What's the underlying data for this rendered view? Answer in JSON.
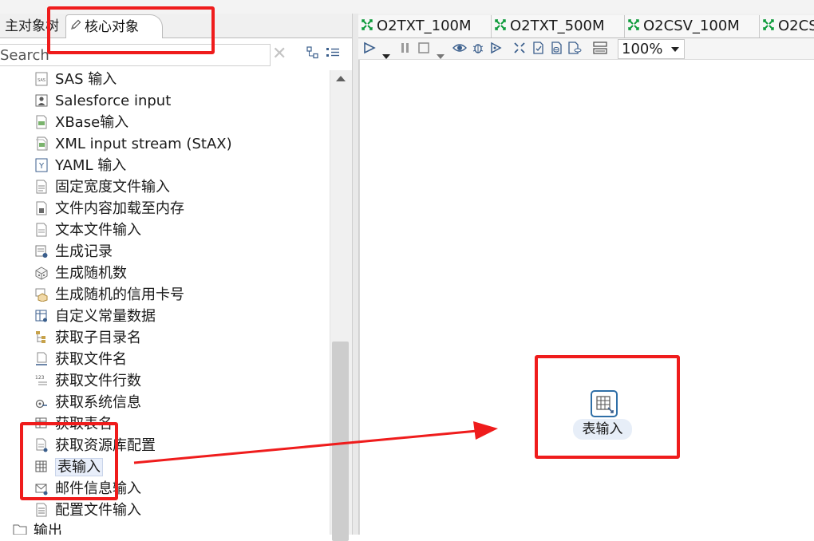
{
  "left_panel": {
    "tabs": [
      {
        "label": "主对象树"
      },
      {
        "label": "核心对象"
      }
    ],
    "search": {
      "placeholder": "Search"
    },
    "tree": {
      "items": [
        {
          "label": "SAS 输入",
          "icon": "sas-input-icon"
        },
        {
          "label": "Salesforce input",
          "icon": "salesforce-input-icon"
        },
        {
          "label": "XBase输入",
          "icon": "xbase-input-icon"
        },
        {
          "label": "XML input stream (StAX)",
          "icon": "xml-input-icon"
        },
        {
          "label": "YAML 输入",
          "icon": "yaml-input-icon"
        },
        {
          "label": "固定宽度文件输入",
          "icon": "fixed-width-file-icon"
        },
        {
          "label": "文件内容加载至内存",
          "icon": "load-file-memory-icon"
        },
        {
          "label": "文本文件输入",
          "icon": "text-file-input-icon"
        },
        {
          "label": "生成记录",
          "icon": "generate-rows-icon"
        },
        {
          "label": "生成随机数",
          "icon": "random-number-icon"
        },
        {
          "label": "生成随机的信用卡号",
          "icon": "random-credit-card-icon"
        },
        {
          "label": "自定义常量数据",
          "icon": "constant-data-icon"
        },
        {
          "label": "获取子目录名",
          "icon": "subfolder-names-icon"
        },
        {
          "label": "获取文件名",
          "icon": "file-names-icon"
        },
        {
          "label": "获取文件行数",
          "icon": "file-row-count-icon"
        },
        {
          "label": "获取系统信息",
          "icon": "system-info-icon"
        },
        {
          "label": "获取表名",
          "icon": "table-names-icon"
        },
        {
          "label": "获取资源库配置",
          "icon": "repository-config-icon"
        },
        {
          "label": "表输入",
          "icon": "table-input-icon",
          "selected": true
        },
        {
          "label": "邮件信息输入",
          "icon": "email-input-icon"
        },
        {
          "label": "配置文件输入",
          "icon": "properties-input-icon"
        }
      ],
      "folder": {
        "label": "输出",
        "icon": "folder-icon"
      }
    }
  },
  "editor": {
    "tabs": [
      {
        "label": "O2TXT_100M"
      },
      {
        "label": "O2TXT_500M"
      },
      {
        "label": "O2CSV_100M"
      },
      {
        "label": "O2CS"
      }
    ],
    "zoom": {
      "value": "100%"
    },
    "canvas_step": {
      "label": "表输入",
      "icon": "table-input-icon"
    }
  },
  "colors": {
    "annotation": "#ef1c1c",
    "step_border": "#2f6fa7",
    "tab_icon": "#0c9a3a"
  }
}
